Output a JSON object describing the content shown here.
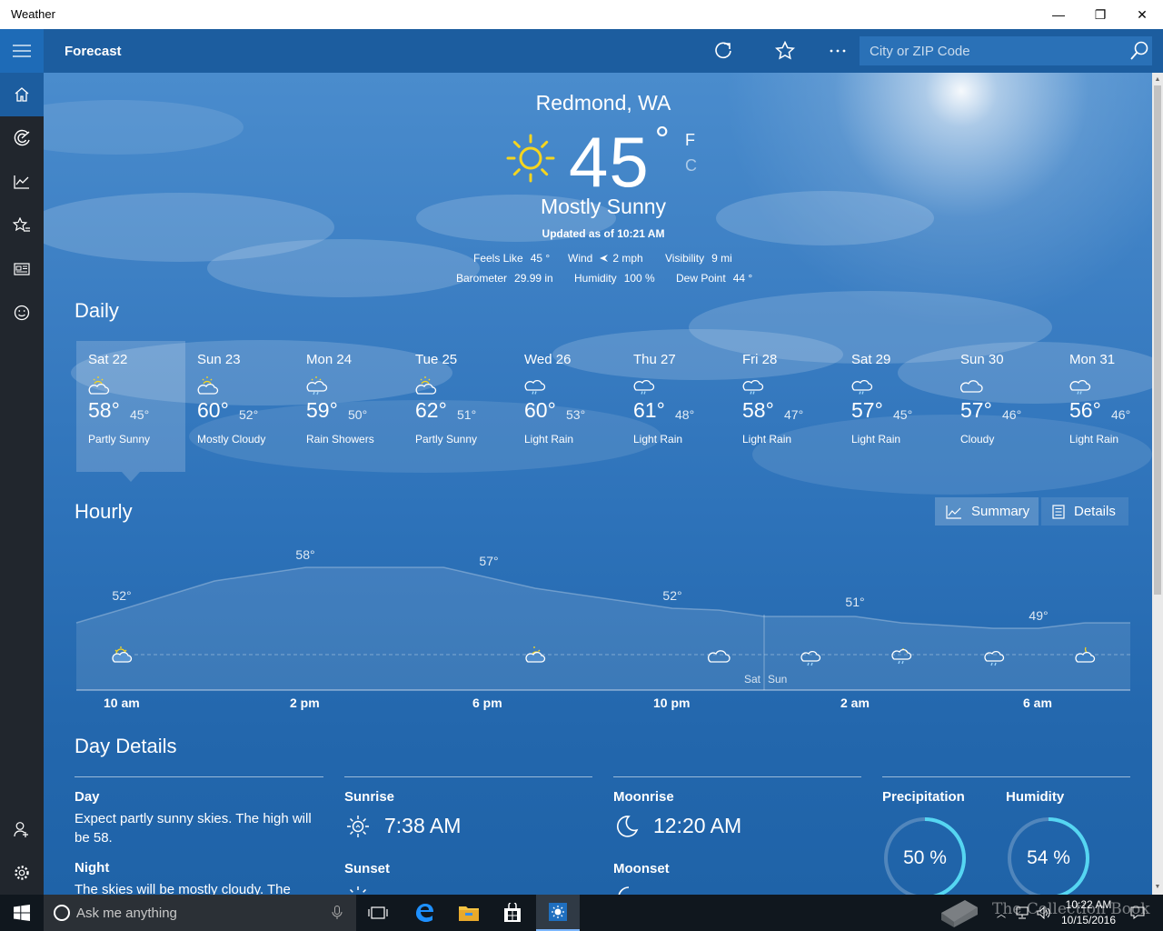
{
  "window": {
    "title": "Weather",
    "minimize": "—",
    "maximize": "❐",
    "close": "✕"
  },
  "header": {
    "section_title": "Forecast",
    "search_placeholder": "City or ZIP Code"
  },
  "current": {
    "location": "Redmond, WA",
    "temperature": "45",
    "degree": "°",
    "unit_f": "F",
    "unit_c": "C",
    "condition": "Mostly Sunny",
    "updated": "Updated as of 10:21 AM",
    "stats": [
      {
        "label": "Feels Like",
        "value": "45 °"
      },
      {
        "label": "Wind",
        "value": "2 mph"
      },
      {
        "label": "Visibility",
        "value": "9 mi"
      },
      {
        "label": "Barometer",
        "value": "29.99 in"
      },
      {
        "label": "Humidity",
        "value": "100 %"
      },
      {
        "label": "Dew Point",
        "value": "44 °"
      }
    ]
  },
  "daily": {
    "heading": "Daily",
    "days": [
      {
        "day": "Sat 22",
        "high": "58°",
        "low": "45°",
        "condition": "Partly Sunny",
        "icon": "partly-sunny-icon"
      },
      {
        "day": "Sun 23",
        "high": "60°",
        "low": "52°",
        "condition": "Mostly Cloudy",
        "icon": "partly-sunny-icon"
      },
      {
        "day": "Mon 24",
        "high": "59°",
        "low": "50°",
        "condition": "Rain Showers",
        "icon": "rain-showers-icon"
      },
      {
        "day": "Tue 25",
        "high": "62°",
        "low": "51°",
        "condition": "Partly Sunny",
        "icon": "partly-sunny-icon"
      },
      {
        "day": "Wed 26",
        "high": "60°",
        "low": "53°",
        "condition": "Light Rain",
        "icon": "light-rain-icon"
      },
      {
        "day": "Thu 27",
        "high": "61°",
        "low": "48°",
        "condition": "Light Rain",
        "icon": "light-rain-icon"
      },
      {
        "day": "Fri 28",
        "high": "58°",
        "low": "47°",
        "condition": "Light Rain",
        "icon": "light-rain-icon"
      },
      {
        "day": "Sat 29",
        "high": "57°",
        "low": "45°",
        "condition": "Light Rain",
        "icon": "light-rain-icon"
      },
      {
        "day": "Sun 30",
        "high": "57°",
        "low": "46°",
        "condition": "Cloudy",
        "icon": "cloudy-icon"
      },
      {
        "day": "Mon 31",
        "high": "56°",
        "low": "46°",
        "condition": "Light Rain",
        "icon": "light-rain-icon"
      }
    ]
  },
  "hourly": {
    "heading": "Hourly",
    "summary_label": "Summary",
    "details_label": "Details",
    "temp_labels": [
      "52°",
      "58°",
      "57°",
      "52°",
      "51°",
      "49°"
    ],
    "time_labels": [
      "10 am",
      "2 pm",
      "6 pm",
      "10 pm",
      "2 am",
      "6 am"
    ],
    "day_separator": [
      "Sat",
      "Sun"
    ]
  },
  "day_details": {
    "heading": "Day Details",
    "day_label": "Day",
    "day_text": "Expect partly sunny skies. The high will be 58.",
    "night_label": "Night",
    "night_text": "The skies will be mostly cloudy. The low",
    "sunrise_label": "Sunrise",
    "sunrise": "7:38 AM",
    "sunset_label": "Sunset",
    "moonrise_label": "Moonrise",
    "moonrise": "12:20 AM",
    "moonset_label": "Moonset",
    "precip_label": "Precipitation",
    "precip_value": "50 %",
    "precip_fraction": 0.5,
    "humidity_label": "Humidity",
    "humidity_value": "54 %",
    "humidity_fraction": 0.54
  },
  "taskbar": {
    "search_placeholder": "Ask me anything",
    "time": "10:22 AM",
    "date": "10/15/2016",
    "watermark": "The Collection Book"
  },
  "colors": {
    "accent": "#1c5d9f",
    "rail": "#21262d",
    "ring": "#55d6f2",
    "sun": "#f5d51f"
  }
}
